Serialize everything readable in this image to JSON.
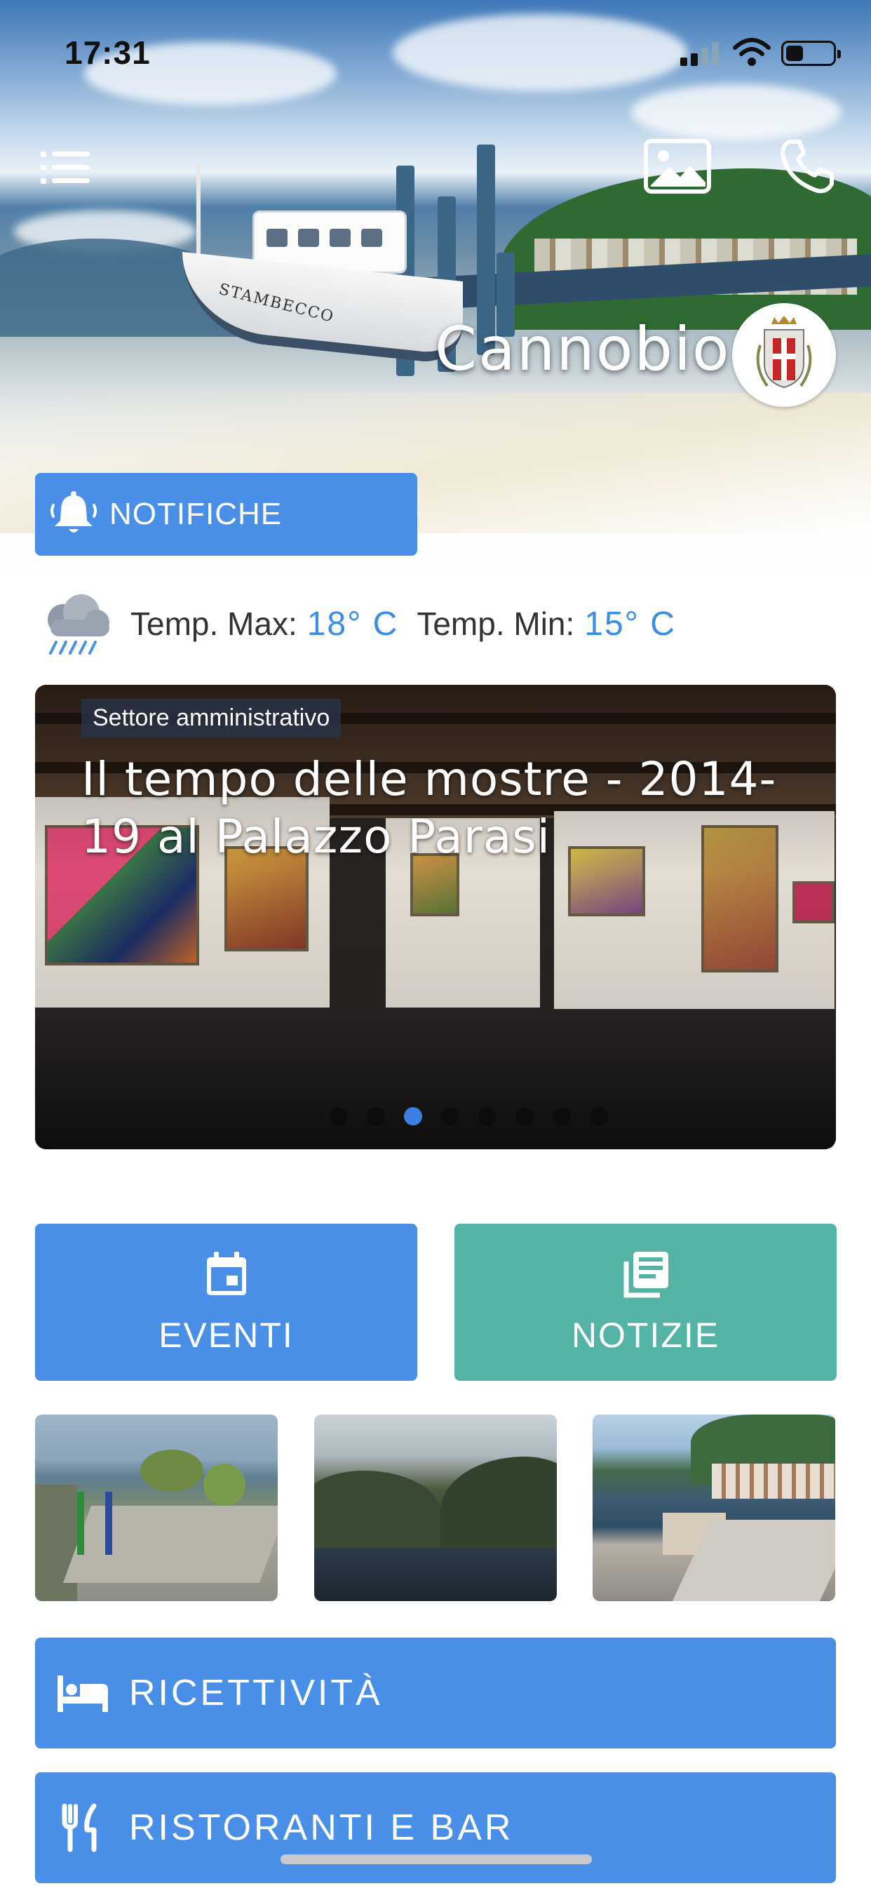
{
  "status_bar": {
    "time": "17:31"
  },
  "header": {
    "town_name": "Cannobio",
    "boat_name": "STAMBECCO",
    "notifications_label": "NOTIFICHE"
  },
  "weather": {
    "icon": "rain-cloud-icon",
    "max_label": "Temp. Max:",
    "max_value": "18° C",
    "min_label": "Temp. Min:",
    "min_value": "15° C"
  },
  "carousel": {
    "category": "Settore amministrativo",
    "title": "Il tempo delle mostre - 2014-19 al Palazzo Parasi",
    "slides_count": 8,
    "active_index": 2
  },
  "tiles": [
    {
      "label": "EVENTI",
      "icon": "calendar-icon",
      "color": "#4a8fe7"
    },
    {
      "label": "NOTIZIE",
      "icon": "newspaper-icon",
      "color": "#55b3a6"
    }
  ],
  "webcams": [
    {
      "name": "webcam-1"
    },
    {
      "name": "webcam-2"
    },
    {
      "name": "webcam-3"
    }
  ],
  "menu_buttons": [
    {
      "label": "RICETTIVITÀ",
      "icon": "bed-icon"
    },
    {
      "label": "RISTORANTI E BAR",
      "icon": "fork-knife-icon"
    }
  ],
  "colors": {
    "accent_blue": "#4a8fe7",
    "accent_teal": "#55b3a6",
    "temp_blue": "#3b8ee5"
  }
}
